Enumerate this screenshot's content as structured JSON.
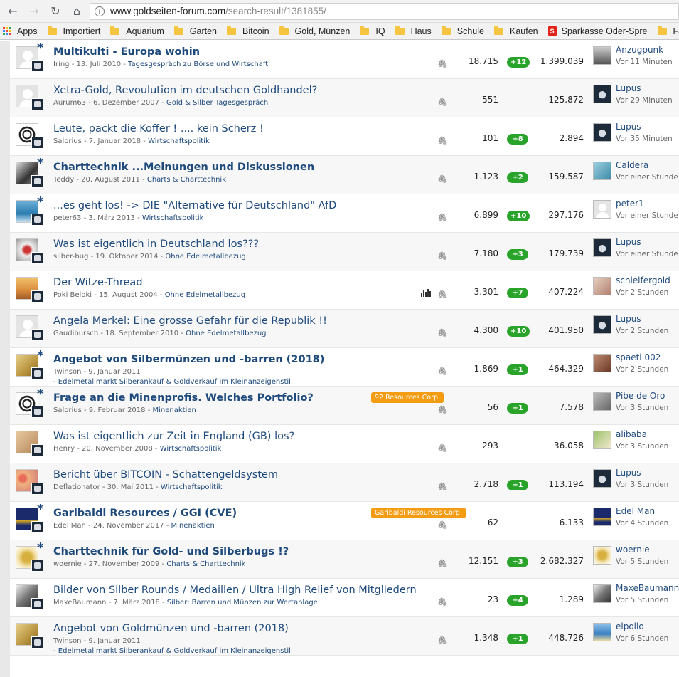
{
  "browser": {
    "url_host": "www.goldseiten-forum.com",
    "url_path": "/search-result/1381855/",
    "bookmarks": [
      {
        "label": "Apps",
        "type": "apps"
      },
      {
        "label": "Importiert",
        "type": "folder"
      },
      {
        "label": "Aquarium",
        "type": "folder"
      },
      {
        "label": "Garten",
        "type": "folder"
      },
      {
        "label": "Bitcoin",
        "type": "folder"
      },
      {
        "label": "Gold, Münzen",
        "type": "folder"
      },
      {
        "label": "IQ",
        "type": "folder"
      },
      {
        "label": "Haus",
        "type": "folder"
      },
      {
        "label": "Schule",
        "type": "folder"
      },
      {
        "label": "Kaufen",
        "type": "folder"
      },
      {
        "label": "Sparkasse Oder-Spre",
        "type": "sparkasse"
      },
      {
        "label": "Fahrs",
        "type": "folder"
      }
    ]
  },
  "threads": [
    {
      "title": "Multikulti - Europa wohin",
      "bold": true,
      "star": true,
      "author": "Iring",
      "date": "13. Juli 2010",
      "forum": "Tagesgespräch zu Börse und Wirtschaft",
      "replies": "18.715",
      "new": "+12",
      "views": "1.399.039",
      "last_user": "Anzugpunk",
      "last_time": "Vor 11 Minuten",
      "avatar": "default",
      "last_avatar": "face"
    },
    {
      "title": "Xetra-Gold, Revoulution im deutschen Goldhandel?",
      "bold": false,
      "star": false,
      "author": "Aurum63",
      "date": "6. Dezember 2007",
      "forum": "Gold & Silber Tagesgespräch",
      "replies": "551",
      "new": "",
      "views": "125.872",
      "last_user": "Lupus",
      "last_time": "Vor 29 Minuten",
      "avatar": "default",
      "last_avatar": "lupus"
    },
    {
      "title": "Leute, packt die Koffer ! .... kein Scherz !",
      "bold": false,
      "star": false,
      "author": "Salorius",
      "date": "7. Januar 2018",
      "forum": "Wirtschaftspolitik",
      "replies": "101",
      "new": "+8",
      "views": "2.894",
      "last_user": "Lupus",
      "last_time": "Vor 35 Minuten",
      "avatar": "spiral",
      "last_avatar": "lupus"
    },
    {
      "title": "Charttechnik ...Meinungen und Diskussionen",
      "bold": true,
      "star": true,
      "author": "Teddy",
      "date": "20. August 2011",
      "forum": "Charts & Charttechnik",
      "replies": "1.123",
      "new": "+2",
      "views": "159.587",
      "last_user": "Caldera",
      "last_time": "Vor einer Stunde",
      "avatar": "bw",
      "last_avatar": "sea"
    },
    {
      "title": "...es geht los! -> DIE \"Alternative für Deutschland\" AfD",
      "bold": false,
      "star": true,
      "author": "peter63",
      "date": "3. März 2013",
      "forum": "Wirtschaftspolitik",
      "replies": "6.899",
      "new": "+10",
      "views": "297.176",
      "last_user": "peter1",
      "last_time": "Vor einer Stunde",
      "avatar": "blue",
      "last_avatar": "default"
    },
    {
      "title": "Was ist eigentlich in Deutschland los???",
      "bold": false,
      "star": false,
      "author": "silber-bug",
      "date": "19. Oktober 2014",
      "forum": "Ohne Edelmetallbezug",
      "replies": "7.180",
      "new": "+3",
      "views": "179.739",
      "last_user": "Lupus",
      "last_time": "Vor einer Stunde",
      "avatar": "red",
      "last_avatar": "lupus"
    },
    {
      "title": "Der Witze-Thread",
      "bold": false,
      "star": false,
      "author": "Poki Beloki",
      "date": "15. August 2004",
      "forum": "Ohne Edelmetallbezug",
      "replies": "3.301",
      "new": "+7",
      "views": "407.224",
      "last_user": "schleifergold",
      "last_time": "Vor 2 Stunden",
      "avatar": "sunset",
      "last_avatar": "skin",
      "chart": true
    },
    {
      "title": "Angela Merkel: Eine grosse Gefahr für die Republik !!",
      "bold": false,
      "star": false,
      "author": "Gaudibursch",
      "date": "18. September 2010",
      "forum": "Ohne Edelmetallbezug",
      "replies": "4.300",
      "new": "+10",
      "views": "401.950",
      "last_user": "Lupus",
      "last_time": "Vor 2 Stunden",
      "avatar": "default",
      "last_avatar": "lupus"
    },
    {
      "title": "Angebot von Silbermünzen und -barren (2018)",
      "bold": true,
      "star": true,
      "author": "Twinson",
      "date": "9. Januar 2011",
      "forum": "Edelmetallmarkt Silberankauf & Goldverkauf im Kleinanzeigenstil",
      "replies": "1.869",
      "new": "+1",
      "views": "464.329",
      "last_user": "spaeti.002",
      "last_time": "Vor 2 Stunden",
      "avatar": "gold",
      "last_avatar": "brown",
      "twoline": true
    },
    {
      "title": "Frage an die Minenprofis. Welches Portfolio?",
      "bold": true,
      "star": true,
      "author": "Salorius",
      "date": "9. Februar 2018",
      "forum": "Minenaktien",
      "replies": "56",
      "new": "+1",
      "views": "7.578",
      "last_user": "Pibe de Oro",
      "last_time": "Vor 3 Stunden",
      "avatar": "spiral",
      "last_avatar": "grey",
      "tag": "92 Resources Corp."
    },
    {
      "title": "Was ist eigentlich zur Zeit in England (GB) los?",
      "bold": false,
      "star": false,
      "author": "Henry",
      "date": "20. November 2008",
      "forum": "Wirtschaftspolitik",
      "replies": "293",
      "new": "",
      "views": "36.058",
      "last_user": "alibaba",
      "last_time": "Vor 3 Stunden",
      "avatar": "tan",
      "last_avatar": "green"
    },
    {
      "title": "Bericht über BITCOIN - Schattengeldsystem",
      "bold": false,
      "star": false,
      "author": "Deflationator",
      "date": "30. Mai 2011",
      "forum": "Wirtschaftspolitik",
      "replies": "2.718",
      "new": "+1",
      "views": "113.194",
      "last_user": "Lupus",
      "last_time": "Vor 3 Stunden",
      "avatar": "flowers",
      "last_avatar": "lupus"
    },
    {
      "title": "Garibaldi Resources / GGI (CVE)",
      "bold": true,
      "star": true,
      "author": "Edel Man",
      "date": "24. November 2017",
      "forum": "Minenaktien",
      "replies": "62",
      "new": "",
      "views": "6.133",
      "last_user": "Edel Man",
      "last_time": "Vor 4 Stunden",
      "avatar": "shield",
      "last_avatar": "shield",
      "tag": "Garibaldi Resources Corp."
    },
    {
      "title": "Charttechnik für Gold- und Silberbugs !?",
      "bold": true,
      "star": true,
      "author": "woernie",
      "date": "27. November 2009",
      "forum": "Charts & Charttechnik",
      "replies": "12.151",
      "new": "+3",
      "views": "2.682.327",
      "last_user": "woernie",
      "last_time": "Vor 5 Stunden",
      "avatar": "goldbull",
      "last_avatar": "goldbull"
    },
    {
      "title": "Bilder von Silber Rounds / Medaillen / Ultra High Relief von Mitgliedern",
      "bold": false,
      "star": false,
      "author": "MaxeBaumann",
      "date": "7. März 2018",
      "forum": "Silber: Barren und Münzen zur Wertanlage",
      "replies": "23",
      "new": "+4",
      "views": "1.289",
      "last_user": "MaxeBaumann",
      "last_time": "Vor 5 Stunden",
      "avatar": "bwface",
      "last_avatar": "bwface"
    },
    {
      "title": "Angebot von Goldmünzen und -barren (2018)",
      "bold": false,
      "star": false,
      "author": "Twinson",
      "date": "9. Januar 2011",
      "forum": "Edelmetallmarkt Silberankauf & Goldverkauf im Kleinanzeigenstil",
      "replies": "1.348",
      "new": "+1",
      "views": "448.726",
      "last_user": "elpollo",
      "last_time": "Vor 6 Stunden",
      "avatar": "gold",
      "last_avatar": "sky",
      "twoline": true
    }
  ],
  "colors": {
    "link": "#1f4a7c",
    "badge": "#2aa32a",
    "tag": "#f39c12"
  }
}
